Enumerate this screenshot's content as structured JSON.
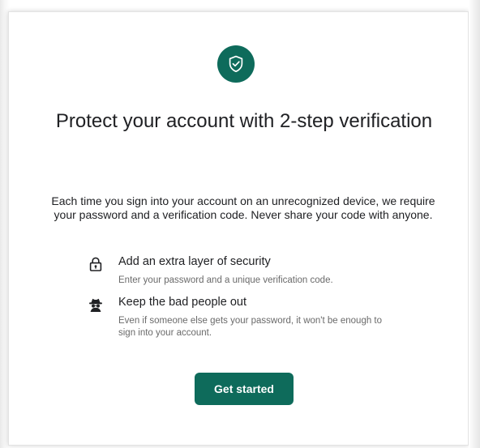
{
  "header": {
    "icon": "shield-check-icon",
    "title": "Protect your account with 2-step verification"
  },
  "description": "Each time you sign into your account on an unrecognized device, we require your password and a verification code. Never share your code with anyone.",
  "features": [
    {
      "icon": "lock-icon",
      "title": "Add an extra layer of security",
      "subtitle": "Enter your password and a unique verification code."
    },
    {
      "icon": "spy-icon",
      "title": "Keep the bad people out",
      "subtitle": "Even if someone else gets your password, it won't be enough to sign into your account."
    }
  ],
  "actions": {
    "get_started_label": "Get started"
  },
  "colors": {
    "accent": "#0e6b5b",
    "text_primary": "#202124",
    "text_secondary": "#6a6a6a"
  }
}
